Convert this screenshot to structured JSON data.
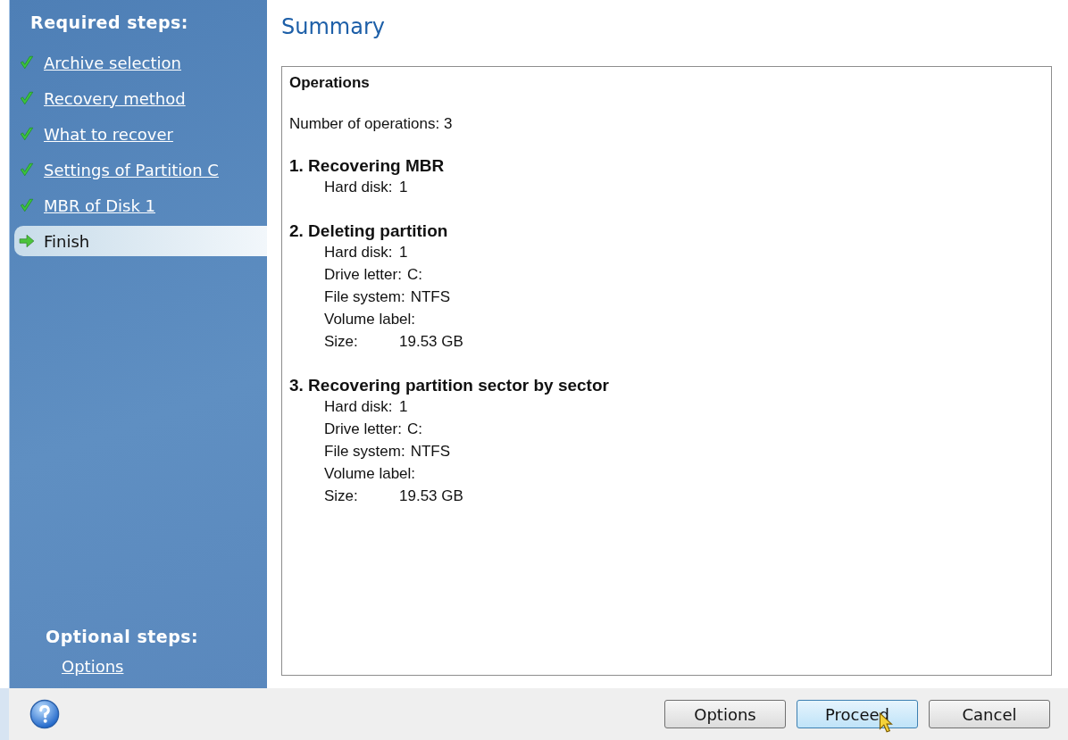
{
  "sidebar": {
    "required_heading": "Required steps:",
    "steps": [
      {
        "label": "Archive selection",
        "completed": true,
        "selected": false
      },
      {
        "label": "Recovery method",
        "completed": true,
        "selected": false
      },
      {
        "label": "What to recover",
        "completed": true,
        "selected": false
      },
      {
        "label": "Settings of Partition C",
        "completed": true,
        "selected": false
      },
      {
        "label": "MBR of Disk 1",
        "completed": true,
        "selected": false
      },
      {
        "label": "Finish",
        "completed": false,
        "selected": true
      }
    ],
    "optional_heading": "Optional steps:",
    "optional_steps": [
      {
        "label": "Options"
      }
    ]
  },
  "title": "Summary",
  "summary": {
    "heading": "Operations",
    "count": "Number of operations: 3",
    "operations": [
      {
        "title": "1. Recovering MBR",
        "details": [
          {
            "label": "Hard disk:",
            "value": "1"
          }
        ]
      },
      {
        "title": "2. Deleting partition",
        "details": [
          {
            "label": "Hard disk:",
            "value": "1"
          },
          {
            "label": "Drive letter:",
            "value": "C:"
          },
          {
            "label": "File system:",
            "value": "NTFS"
          },
          {
            "label": "Volume label:"
          },
          {
            "label": "Size:",
            "value": "19.53 GB"
          }
        ]
      },
      {
        "title": "3. Recovering partition sector by sector",
        "details": [
          {
            "label": "Hard disk:",
            "value": "1"
          },
          {
            "label": "Drive letter:",
            "value": "C:"
          },
          {
            "label": "File system:",
            "value": "NTFS"
          },
          {
            "label": "Volume label:"
          },
          {
            "label": "Size:",
            "value": "19.53 GB"
          }
        ]
      }
    ]
  },
  "buttons": [
    {
      "label": "Options",
      "default": false
    },
    {
      "label": "Proceed",
      "default": true
    },
    {
      "label": "Cancel",
      "default": false
    }
  ]
}
